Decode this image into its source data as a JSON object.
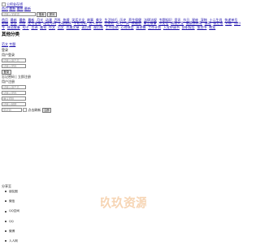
{
  "logo": {
    "alt": "公积金在线"
  },
  "top_links": [
    "首页",
    "最新",
    "最热",
    "最新"
  ],
  "search": {
    "placeholder": "请输入关键词",
    "button1": "搜索",
    "button2": "提问"
  },
  "nav_items": [
    "首页",
    "最新",
    "最热",
    "最新",
    "月光",
    "动漫",
    "百科",
    "热搜",
    "笑话大全",
    "故事",
    "美文",
    "生活技巧",
    "历史",
    "养生保健",
    "法律法规",
    "专题知识",
    "资讯",
    "节日",
    "星座",
    "宠物",
    "十二生肖",
    "快递单号",
    "邮编",
    "旅游",
    "问答",
    "区号查询",
    "电话号码",
    "心理测试",
    "手机号码",
    "名人名言",
    "百家姓",
    "开心一刻",
    "祝福语",
    "寓言故事",
    "冷笑话",
    "成语大全",
    "脑筋急转弯",
    "谜语",
    "歇后语",
    "对联",
    "绕口令",
    "成语故事",
    "句子",
    "古诗",
    "美句",
    "作文",
    "范文",
    "优美文章",
    "读后感",
    "观后感",
    "工作总结",
    "心得体会",
    "演讲稿",
    "工作计划",
    "入党申请书",
    "辞职报告",
    "策划书",
    "教案"
  ],
  "section_title": "其他分类",
  "tabs": [
    "范文",
    "专题"
  ],
  "login": {
    "heading": "登录",
    "sub_heading": "用户登录",
    "user_placeholder": "请输入用户名",
    "pass_placeholder": "请输入密码",
    "submit": "登录",
    "links": "忘记密码 | 立即注册"
  },
  "register": {
    "heading": "用户注册",
    "user_placeholder": "请输入用户名",
    "pass_placeholder": "请输入密码",
    "pass2_placeholder": "确认密码",
    "email_placeholder": "请输入邮箱",
    "code_placeholder": "验证码",
    "captcha_alt": "点击刷新",
    "submit": "注册"
  },
  "share": {
    "title": "分享至",
    "items": [
      "朋友圈",
      "微信",
      "QQ空间",
      "QQ",
      "微博",
      "人人网"
    ]
  },
  "watermark_text": "玖玖资源"
}
